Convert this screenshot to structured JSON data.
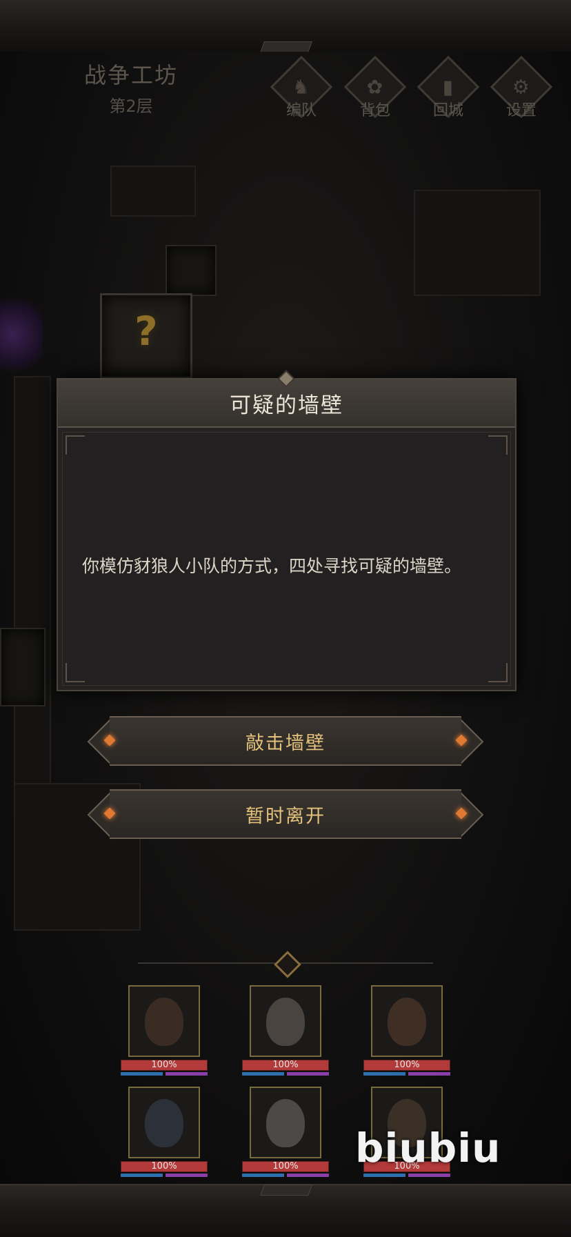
{
  "header": {
    "area_name": "战争工坊",
    "floor_label": "第2层",
    "buttons": [
      {
        "label": "编队",
        "icon": "helmet-icon"
      },
      {
        "label": "背包",
        "icon": "bag-icon"
      },
      {
        "label": "回城",
        "icon": "door-icon"
      },
      {
        "label": "设置",
        "icon": "gear-icon"
      }
    ]
  },
  "dialog": {
    "title": "可疑的墙壁",
    "text": "你模仿豺狼人小队的方式，四处寻找可疑的墙壁。"
  },
  "options": [
    {
      "label": "敲击墙壁"
    },
    {
      "label": "暂时离开"
    }
  ],
  "party": [
    {
      "hp": "100%",
      "portrait_color": "#3a2c22"
    },
    {
      "hp": "100%",
      "portrait_color": "#4a4440"
    },
    {
      "hp": "100%",
      "portrait_color": "#3e2e24"
    },
    {
      "hp": "100%",
      "portrait_color": "#2c3038"
    },
    {
      "hp": "100%",
      "portrait_color": "#4c4a48"
    },
    {
      "hp": "100%",
      "portrait_color": "#3a3026"
    }
  ],
  "watermark": "biubiu",
  "colors": {
    "accent_gold": "#e4c27c",
    "gem_orange": "#e07a33",
    "hp_red": "#b23a3a",
    "mp_blue": "#2e6fae"
  }
}
